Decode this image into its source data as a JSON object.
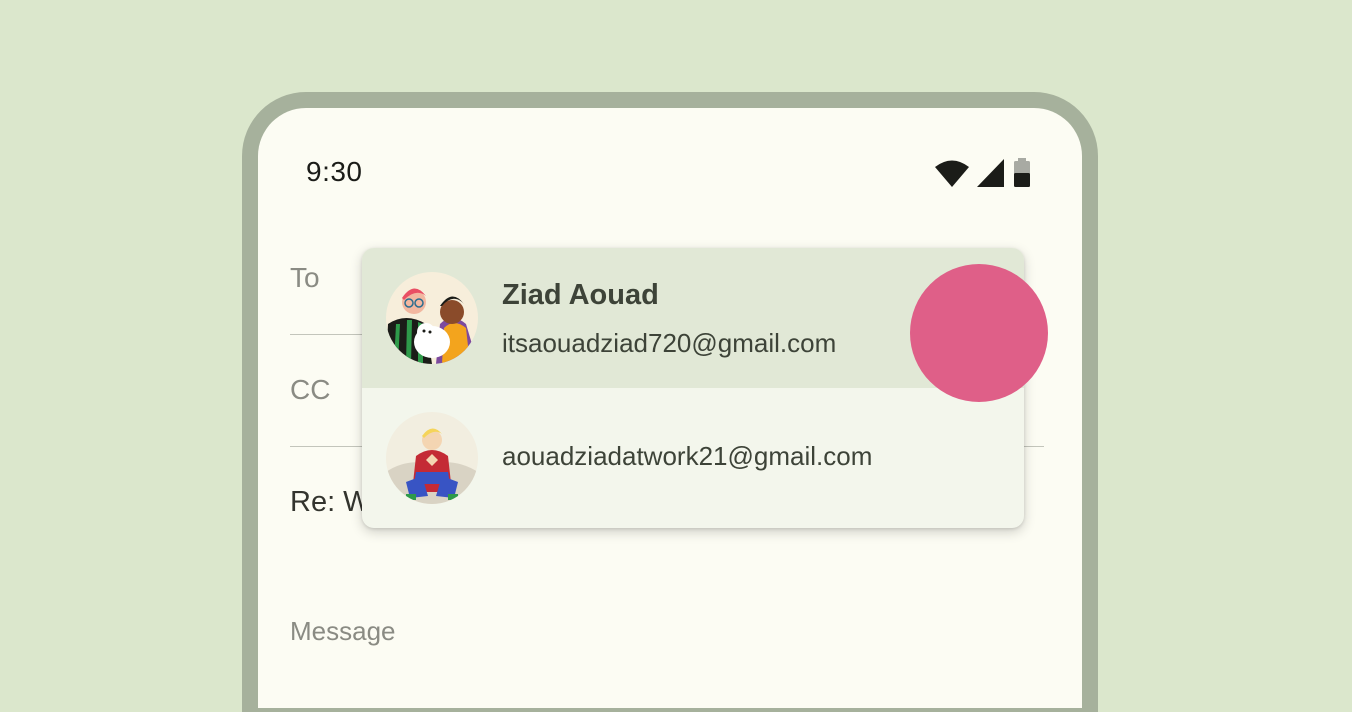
{
  "status_bar": {
    "time": "9:30",
    "icons": [
      "wifi-icon",
      "cell-signal-icon",
      "battery-icon"
    ]
  },
  "compose": {
    "to_label": "To",
    "cc_label": "CC",
    "subject": "Re: W",
    "message_placeholder": "Message"
  },
  "suggestions": [
    {
      "name": "Ziad Aouad",
      "email": "itsaouadziad720@gmail.com",
      "avatar": "avatar-two-people-with-dog"
    },
    {
      "name": "",
      "email": "aouadziadatwork21@gmail.com",
      "avatar": "avatar-person-sitting"
    }
  ],
  "colors": {
    "background": "#dbe7cc",
    "phone_frame": "#a6b19c",
    "screen": "#fcfcf3",
    "dropdown": "#f3f6ec",
    "selected_row": "#e1e8d6",
    "touch_indicator": "#df5f88"
  }
}
